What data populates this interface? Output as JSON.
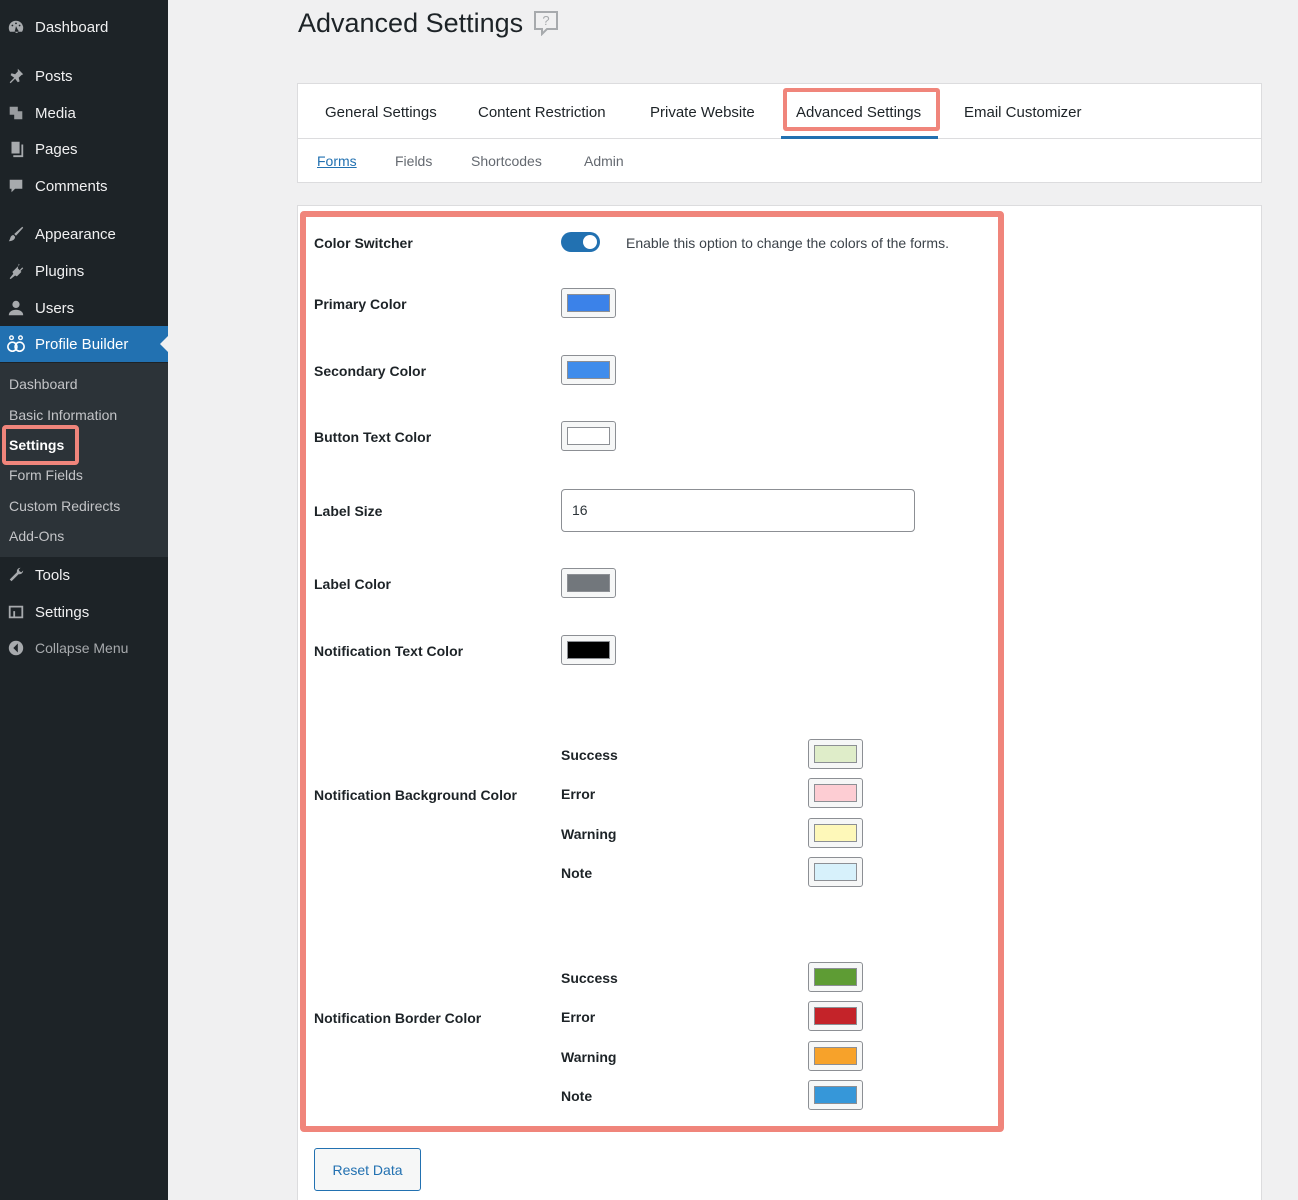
{
  "sidebar": {
    "items": [
      {
        "label": "Dashboard",
        "icon": "dashboard-icon"
      },
      {
        "label": "Posts",
        "icon": "pin-icon"
      },
      {
        "label": "Media",
        "icon": "media-icon"
      },
      {
        "label": "Pages",
        "icon": "pages-icon"
      },
      {
        "label": "Comments",
        "icon": "comment-icon"
      },
      {
        "label": "Appearance",
        "icon": "paintbrush-icon"
      },
      {
        "label": "Plugins",
        "icon": "plug-icon"
      },
      {
        "label": "Users",
        "icon": "user-icon"
      },
      {
        "label": "Profile Builder",
        "icon": "profile-builder-icon"
      },
      {
        "label": "Tools",
        "icon": "wrench-icon"
      },
      {
        "label": "Settings",
        "icon": "settings-icon"
      }
    ],
    "submenu": [
      "Dashboard",
      "Basic Information",
      "Settings",
      "Form Fields",
      "Custom Redirects",
      "Add-Ons"
    ],
    "collapse_label": "Collapse Menu"
  },
  "page": {
    "title": "Advanced Settings"
  },
  "tabs": [
    "General Settings",
    "Content Restriction",
    "Private Website",
    "Advanced Settings",
    "Email Customizer"
  ],
  "subtabs": [
    "Forms",
    "Fields",
    "Shortcodes",
    "Admin"
  ],
  "form": {
    "color_switcher": {
      "label": "Color Switcher",
      "enabled": true,
      "description": "Enable this option to change the colors of the forms."
    },
    "primary_color": {
      "label": "Primary Color",
      "color": "#3b82e9"
    },
    "secondary_color": {
      "label": "Secondary Color",
      "color": "#3f8ceb"
    },
    "button_text_color": {
      "label": "Button Text Color",
      "color": "#ffffff"
    },
    "label_size": {
      "label": "Label Size",
      "value": "16"
    },
    "label_color": {
      "label": "Label Color",
      "color": "#72777c"
    },
    "notification_text_color": {
      "label": "Notification Text Color",
      "color": "#000000"
    },
    "notification_bg": {
      "label": "Notification Background Color",
      "items": [
        {
          "name": "Success",
          "color": "#dfedc9"
        },
        {
          "name": "Error",
          "color": "#fdcdd3"
        },
        {
          "name": "Warning",
          "color": "#fef8b9"
        },
        {
          "name": "Note",
          "color": "#d7f1fb"
        }
      ]
    },
    "notification_border": {
      "label": "Notification Border Color",
      "items": [
        {
          "name": "Success",
          "color": "#5e9c34"
        },
        {
          "name": "Error",
          "color": "#c42329"
        },
        {
          "name": "Warning",
          "color": "#f7a22a"
        },
        {
          "name": "Note",
          "color": "#3697d9"
        }
      ]
    }
  },
  "reset_button": "Reset Data"
}
